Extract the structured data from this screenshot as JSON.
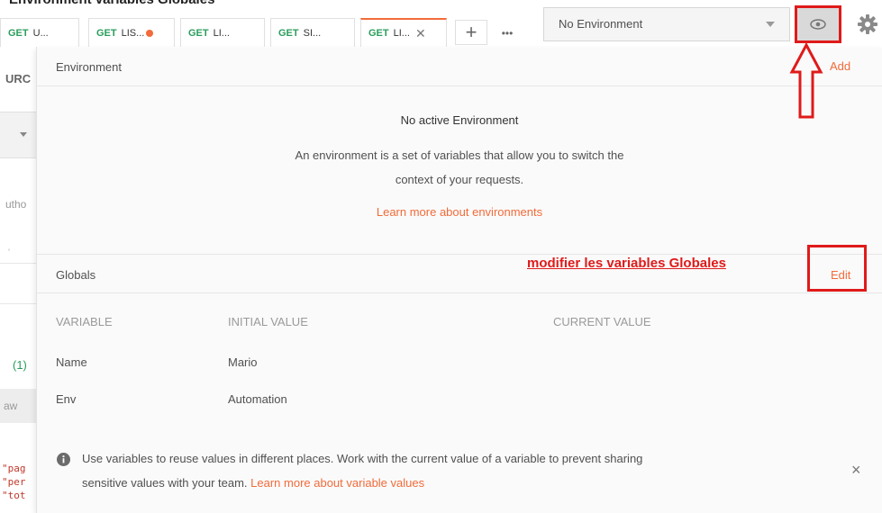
{
  "top_partial_text": "Environment variables Globales",
  "tabs": [
    {
      "method": "GET",
      "title": "U..."
    },
    {
      "method": "GET",
      "title": "LIS..."
    },
    {
      "method": "GET",
      "title": "LI..."
    },
    {
      "method": "GET",
      "title": "SI..."
    },
    {
      "method": "GET",
      "title": "LI..."
    }
  ],
  "tab_add_label": "+",
  "tab_more_label": "•••",
  "tab_close_label": "✕",
  "left_pane": {
    "url_fragment": "URC",
    "auth_fragment": "utho",
    "count_fragment": "(1)",
    "raw_fragment": "aw",
    "json_lines": [
      "\"pag",
      "\"per",
      "\"tot"
    ]
  },
  "environment_select": {
    "value": "No Environment"
  },
  "panel": {
    "env_header": "Environment",
    "add_label": "Add",
    "no_env_title": "No active Environment",
    "no_env_desc_1": "An environment is a set of variables that allow you to switch the",
    "no_env_desc_2": "context of your requests.",
    "learn_env_link": "Learn more about environments",
    "globals_header": "Globals",
    "edit_label": "Edit",
    "annotation": "modifier les variables Globales",
    "columns": [
      "VARIABLE",
      "INITIAL VALUE",
      "CURRENT VALUE"
    ],
    "rows": [
      {
        "variable": "Name",
        "initial": "Mario",
        "current": ""
      },
      {
        "variable": "Env",
        "initial": "Automation",
        "current": ""
      }
    ],
    "info_text_1": "Use variables to reuse values in different places. Work with the current value of a variable to prevent sharing",
    "info_text_2": "sensitive values with your team.",
    "info_link": "Learn more about variable values",
    "info_close": "×"
  },
  "colors": {
    "accent": "#f26b3a",
    "method_get": "#2a9d5c",
    "annotation_red": "#e01a1a"
  }
}
